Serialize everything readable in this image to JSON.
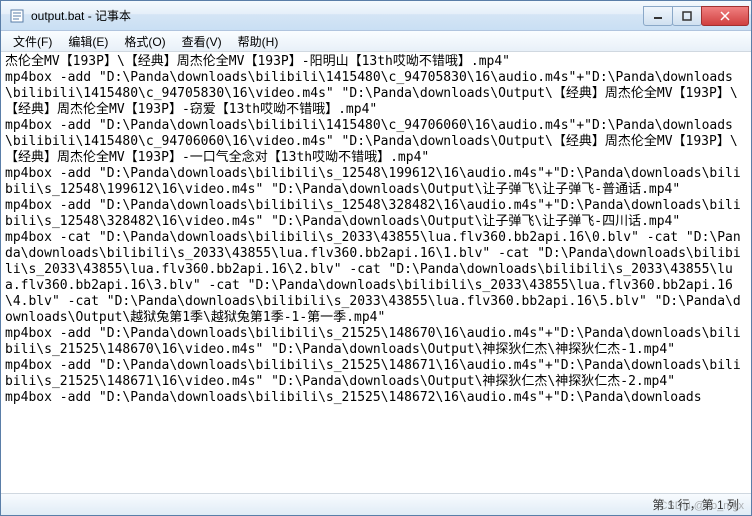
{
  "window": {
    "title": "output.bat - 记事本"
  },
  "menu": {
    "file": "文件(F)",
    "edit": "编辑(E)",
    "format": "格式(O)",
    "view": "查看(V)",
    "help": "帮助(H)"
  },
  "content": "杰伦全MV【193P】\\【经典】周杰伦全MV【193P】-阳明山【13th哎呦不错哦】.mp4\"\nmp4box -add \"D:\\Panda\\downloads\\bilibili\\1415480\\c_94705830\\16\\audio.m4s\"+\"D:\\Panda\\downloads\\bilibili\\1415480\\c_94705830\\16\\video.m4s\" \"D:\\Panda\\downloads\\Output\\【经典】周杰伦全MV【193P】\\【经典】周杰伦全MV【193P】-窃爱【13th哎呦不错哦】.mp4\"\nmp4box -add \"D:\\Panda\\downloads\\bilibili\\1415480\\c_94706060\\16\\audio.m4s\"+\"D:\\Panda\\downloads\\bilibili\\1415480\\c_94706060\\16\\video.m4s\" \"D:\\Panda\\downloads\\Output\\【经典】周杰伦全MV【193P】\\【经典】周杰伦全MV【193P】-一口气全念对【13th哎呦不错哦】.mp4\"\nmp4box -add \"D:\\Panda\\downloads\\bilibili\\s_12548\\199612\\16\\audio.m4s\"+\"D:\\Panda\\downloads\\bilibili\\s_12548\\199612\\16\\video.m4s\" \"D:\\Panda\\downloads\\Output\\让子弹飞\\让子弹飞-普通话.mp4\"\nmp4box -add \"D:\\Panda\\downloads\\bilibili\\s_12548\\328482\\16\\audio.m4s\"+\"D:\\Panda\\downloads\\bilibili\\s_12548\\328482\\16\\video.m4s\" \"D:\\Panda\\downloads\\Output\\让子弹飞\\让子弹飞-四川话.mp4\"\nmp4box -cat \"D:\\Panda\\downloads\\bilibili\\s_2033\\43855\\lua.flv360.bb2api.16\\0.blv\" -cat \"D:\\Panda\\downloads\\bilibili\\s_2033\\43855\\lua.flv360.bb2api.16\\1.blv\" -cat \"D:\\Panda\\downloads\\bilibili\\s_2033\\43855\\lua.flv360.bb2api.16\\2.blv\" -cat \"D:\\Panda\\downloads\\bilibili\\s_2033\\43855\\lua.flv360.bb2api.16\\3.blv\" -cat \"D:\\Panda\\downloads\\bilibili\\s_2033\\43855\\lua.flv360.bb2api.16\\4.blv\" -cat \"D:\\Panda\\downloads\\bilibili\\s_2033\\43855\\lua.flv360.bb2api.16\\5.blv\" \"D:\\Panda\\downloads\\Output\\越狱兔第1季\\越狱兔第1季-1-第一季.mp4\"\nmp4box -add \"D:\\Panda\\downloads\\bilibili\\s_21525\\148670\\16\\audio.m4s\"+\"D:\\Panda\\downloads\\bilibili\\s_21525\\148670\\16\\video.m4s\" \"D:\\Panda\\downloads\\Output\\神探狄仁杰\\神探狄仁杰-1.mp4\"\nmp4box -add \"D:\\Panda\\downloads\\bilibili\\s_21525\\148671\\16\\audio.m4s\"+\"D:\\Panda\\downloads\\bilibili\\s_21525\\148671\\16\\video.m4s\" \"D:\\Panda\\downloads\\Output\\神探狄仁杰\\神探狄仁杰-2.mp4\"\nmp4box -add \"D:\\Panda\\downloads\\bilibili\\s_21525\\148672\\16\\audio.m4s\"+\"D:\\Panda\\downloads",
  "status": {
    "position": "第 1 行，第 1 列"
  },
  "watermark": "CSDN @ho_mgx"
}
